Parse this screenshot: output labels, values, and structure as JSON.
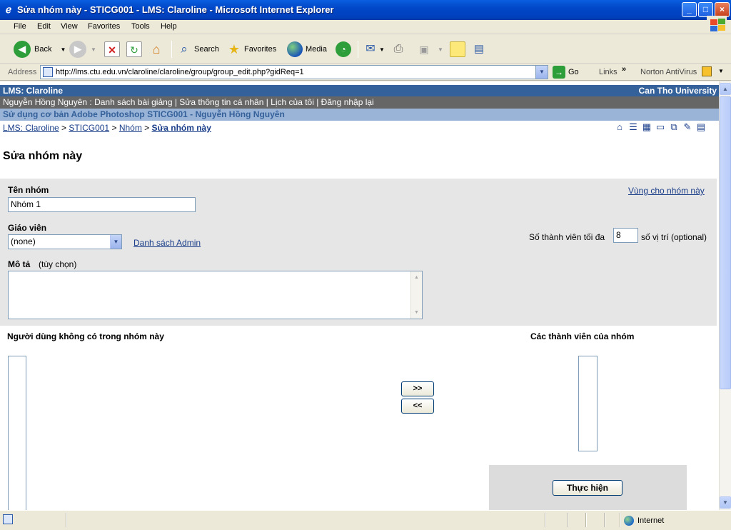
{
  "window": {
    "title": "Sửa nhóm này - STICG001 - LMS: Claroline - Microsoft Internet Explorer",
    "min": "_",
    "max": "□",
    "close": "×"
  },
  "menu": [
    "File",
    "Edit",
    "View",
    "Favorites",
    "Tools",
    "Help"
  ],
  "toolbar": {
    "back": "Back",
    "search": "Search",
    "favorites": "Favorites",
    "media": "Media"
  },
  "address": {
    "label": "Address",
    "url": "http://lms.ctu.edu.vn/claroline/claroline/group/group_edit.php?gidReq=1",
    "go": "Go",
    "links": "Links",
    "norton": "Norton AntiVirus"
  },
  "page": {
    "site_name": "LMS: Claroline",
    "institution": "Can Tho University",
    "user_bar": "Nguyễn Hồng Nguyên : Danh sách bài giảng | Sửa thông tin cá nhân | Lịch của tôi | Đăng nhập lại",
    "course_bar": "Sử dụng cơ bản Adobe Photoshop STICG001 - Nguyễn Hồng Nguyên",
    "breadcrumb": {
      "home": "LMS: Claroline",
      "sep": ">",
      "course": "STICG001",
      "groups": "Nhóm",
      "current": "Sửa nhóm này"
    },
    "title": "Sửa nhóm này"
  },
  "form": {
    "group_name_label": "Tên nhóm",
    "group_name_value": "Nhóm 1",
    "group_area_link": "Vùng cho nhóm này",
    "tutor_label": "Giáo viên",
    "tutor_value": "(none)",
    "admin_list_link": "Danh sách Admin",
    "max_members_label": "Số thành viên tối đa",
    "max_members_value": "8",
    "max_members_suffix": "số vị trí (optional)",
    "description_label": "Mô tả",
    "description_optional": "(tùy chọn)",
    "description_value": "",
    "non_members_label": "Người dùng không có trong nhóm này",
    "members_label": "Các thành viên của nhóm",
    "add_button": ">>",
    "remove_button": "<<",
    "submit_button": "Thực hiện"
  },
  "status": {
    "zone": "Internet"
  }
}
